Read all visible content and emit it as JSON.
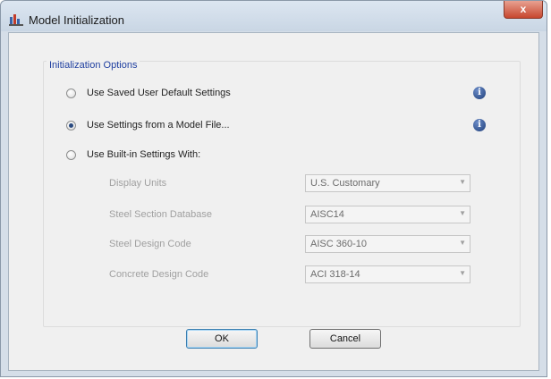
{
  "window": {
    "title": "Model Initialization",
    "close_label": "x"
  },
  "group": {
    "label": "Initialization Options"
  },
  "options": [
    {
      "label": "Use Saved User Default Settings",
      "checked": false
    },
    {
      "label": "Use Settings from a Model File...",
      "checked": true
    },
    {
      "label": "Use Built-in Settings With:",
      "checked": false
    }
  ],
  "info_icon_glyph": "i",
  "settings": [
    {
      "label": "Display Units",
      "value": "U.S. Customary"
    },
    {
      "label": "Steel Section Database",
      "value": "AISC14"
    },
    {
      "label": "Steel Design Code",
      "value": "AISC 360-10"
    },
    {
      "label": "Concrete Design Code",
      "value": "ACI 318-14"
    }
  ],
  "dropdown_arrow": "▼",
  "buttons": {
    "ok": "OK",
    "cancel": "Cancel"
  },
  "colors": {
    "group_label": "#1f3fa0",
    "info_icon": "#1f3f7a",
    "disabled_text": "#a0a0a0"
  }
}
